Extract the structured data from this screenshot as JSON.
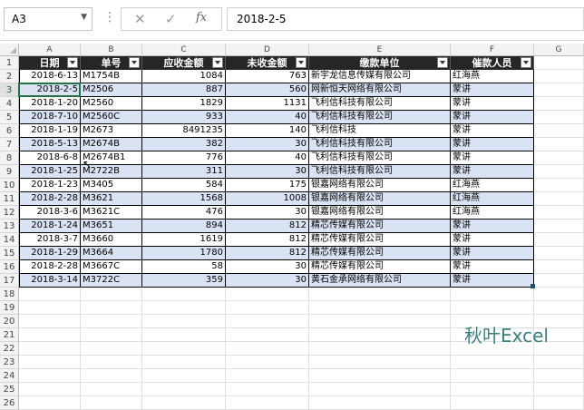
{
  "name_box": {
    "value": "A3"
  },
  "formula_bar": {
    "value": "2018-2-5",
    "fx_label": "fx"
  },
  "columns": [
    "A",
    "B",
    "C",
    "D",
    "E",
    "F",
    "G"
  ],
  "header_row": [
    "日期",
    "单号",
    "应收金额",
    "未收金额",
    "缴款单位",
    "催款人员"
  ],
  "rows": [
    [
      "2018-6-13",
      "M1754B",
      "1084",
      "763",
      "新宇龙信息传媒有限公司",
      "红海燕"
    ],
    [
      "2018-2-5",
      "M2506",
      "887",
      "560",
      "网新恒天网络有限公司",
      "蒙讲"
    ],
    [
      "2018-1-20",
      "M2560",
      "1829",
      "1131",
      "飞利信科技有限公司",
      "蒙讲"
    ],
    [
      "2018-7-10",
      "M2560C",
      "933",
      "40",
      "飞利信科技有限公司",
      "蒙讲"
    ],
    [
      "2018-1-19",
      "M2673",
      "8491235",
      "140",
      "飞利信科技",
      "蒙讲"
    ],
    [
      "2018-5-13",
      "M2674B",
      "382",
      "30",
      "飞利信科技有限公司",
      "蒙讲"
    ],
    [
      "2018-6-8",
      "M2674B1",
      "776",
      "40",
      "飞利信科技有限公司",
      "蒙讲"
    ],
    [
      "2018-1-25",
      "M2722B",
      "311",
      "30",
      "飞利信科技有限公司",
      "蒙讲"
    ],
    [
      "2018-1-23",
      "M3405",
      "584",
      "175",
      "银嘉网络有限公司",
      "红海燕"
    ],
    [
      "2018-2-28",
      "M3621",
      "1568",
      "1008",
      "银嘉网络有限公司",
      "红海燕"
    ],
    [
      "2018-3-6",
      "M3621C",
      "476",
      "30",
      "银嘉网络有限公司",
      "红海燕"
    ],
    [
      "2018-1-24",
      "M3651",
      "894",
      "812",
      "精芯传媒有限公司",
      "蒙讲"
    ],
    [
      "2018-3-7",
      "M3660",
      "1619",
      "812",
      "精芯传媒有限公司",
      "蒙讲"
    ],
    [
      "2018-1-29",
      "M3664",
      "1780",
      "812",
      "精芯传媒有限公司",
      "蒙讲"
    ],
    [
      "2018-2-28",
      "M3667C",
      "58",
      "30",
      "精芯传媒有限公司",
      "蒙讲"
    ],
    [
      "2018-3-14",
      "M3722C",
      "359",
      "30",
      "黄石金承网络有限公司",
      "蒙讲"
    ]
  ],
  "row_numbers": [
    "1",
    "2",
    "3",
    "4",
    "5",
    "6",
    "7",
    "8",
    "9",
    "10",
    "11",
    "12",
    "13",
    "14",
    "15",
    "16",
    "17",
    "18",
    "19",
    "20",
    "21",
    "22",
    "23",
    "24",
    "25",
    "26"
  ],
  "watermark": "秋叶Excel",
  "colors": {
    "header_bg": "#262626",
    "band": "#dae3f3",
    "watermark": "#3e7f7f"
  }
}
